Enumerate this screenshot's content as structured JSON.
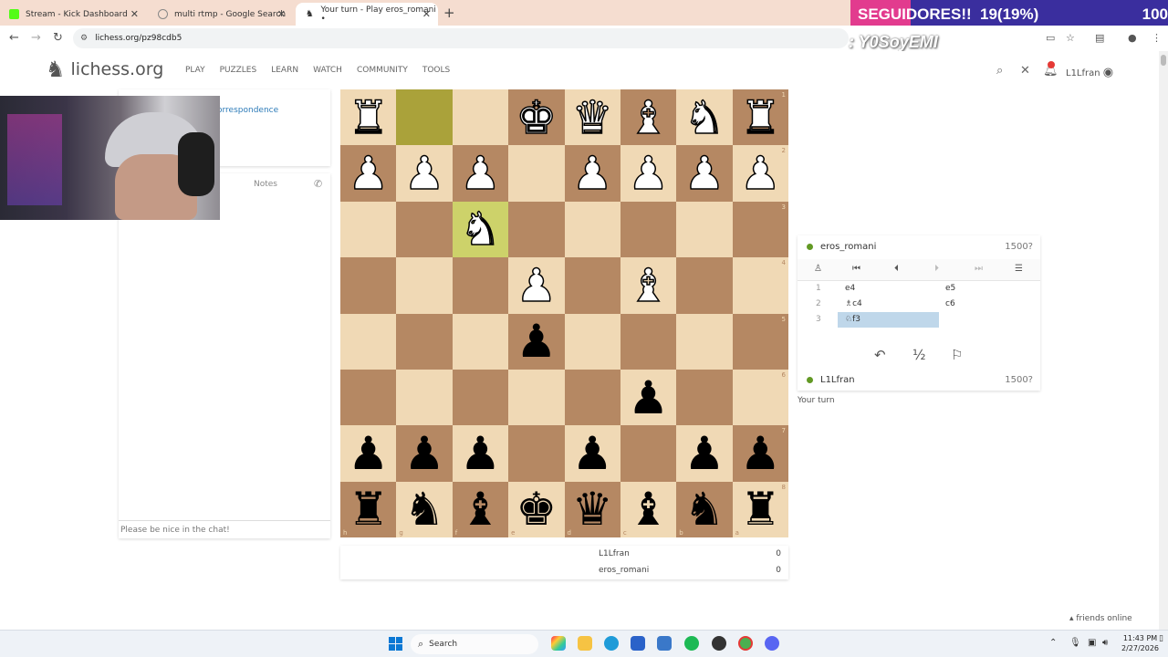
{
  "browser": {
    "tabs": [
      {
        "title": "Stream - Kick Dashboard",
        "active": false
      },
      {
        "title": "multi rtmp - Google Search",
        "active": false
      },
      {
        "title": "Your turn - Play eros_romani • ",
        "active": true
      }
    ],
    "url": "lichess.org/pz98cdb5"
  },
  "overlay": {
    "followers_label": "SEGUIDORES!!",
    "followers_value": "19(19%)",
    "followers_goal": "100",
    "followers_progress": 0.19,
    "handle": ": Y0SoyEMI"
  },
  "site": {
    "brand": "lichess.org",
    "nav": [
      "PLAY",
      "PUZZLES",
      "LEARN",
      "WATCH",
      "COMMUNITY",
      "TOOLS"
    ],
    "notification_count": "1",
    "username": "L1Lfran"
  },
  "left": {
    "game_type_link": "orrespondence",
    "notes_tab": "Notes",
    "chat_placeholder": "Please be nice in the chat!"
  },
  "board": {
    "ranks_right": [
      "1",
      "2",
      "3",
      "4",
      "5",
      "6",
      "7",
      "8"
    ],
    "files_bottom": [
      "h",
      "g",
      "f",
      "e",
      "d",
      "c",
      "b",
      "a"
    ],
    "rows": [
      [
        "wR",
        "",
        "",
        "wK",
        "wQ",
        "wB",
        "wN",
        "wR"
      ],
      [
        "wP",
        "wP",
        "wP",
        "",
        "wP",
        "wP",
        "wP",
        "wP"
      ],
      [
        "",
        "",
        "wN",
        "",
        "",
        "",
        "",
        ""
      ],
      [
        "",
        "",
        "",
        "wP",
        "",
        "wB",
        "",
        ""
      ],
      [
        "",
        "",
        "",
        "bP",
        "",
        "",
        "",
        ""
      ],
      [
        "",
        "",
        "",
        "",
        "",
        "bP",
        "",
        ""
      ],
      [
        "bP",
        "bP",
        "bP",
        "",
        "bP",
        "",
        "bP",
        "bP"
      ],
      [
        "bR",
        "bN",
        "bB",
        "bK",
        "bQ",
        "bB",
        "bN",
        "bR"
      ]
    ],
    "highlight_from": [
      0,
      1
    ],
    "highlight_to": [
      2,
      2
    ]
  },
  "scores": [
    {
      "name": "L1Lfran",
      "score": "0"
    },
    {
      "name": "eros_romani",
      "score": "0"
    }
  ],
  "game": {
    "opponent": {
      "name": "eros_romani",
      "rating": "1500?"
    },
    "player": {
      "name": "L1Lfran",
      "rating": "1500?"
    },
    "moves": [
      {
        "n": "1",
        "white": "e4",
        "black": "e5"
      },
      {
        "n": "2",
        "white": "♗c4",
        "black": "c6"
      },
      {
        "n": "3",
        "white": "♘f3",
        "black": ""
      }
    ],
    "draw_label": "½",
    "status": "Your turn"
  },
  "footer": {
    "friends": "friends online"
  },
  "taskbar": {
    "search_label": "Search",
    "time": "11:43 PM",
    "date": "2/27/2026"
  },
  "colors": {
    "light_square": "#f0d9b5",
    "dark_square": "#b58863",
    "highlight_light": "#cdd26a",
    "highlight_dark": "#aaa23a",
    "accent_green": "#629924",
    "current_move": "#bfd7ea"
  }
}
